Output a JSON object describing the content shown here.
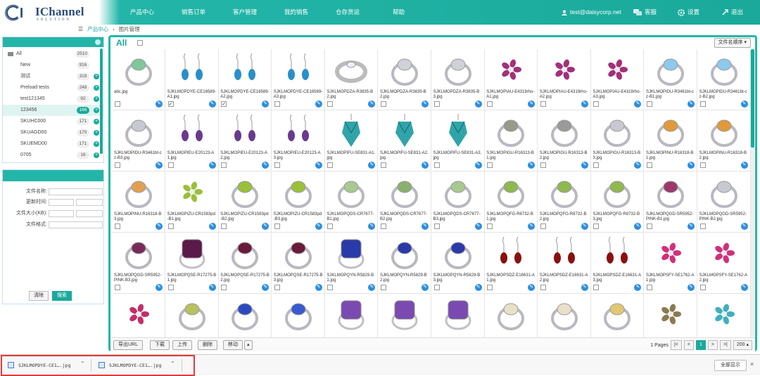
{
  "brand": {
    "name": "IChannel",
    "tagline": "SOLUTION"
  },
  "nav": {
    "items": [
      "产品中心",
      "销售订单",
      "客户管理",
      "我的销售",
      "仓存货运",
      "帮助"
    ],
    "user": "test@daisycorp.net",
    "service": "客服",
    "settings": "设置",
    "logout": "退出"
  },
  "breadcrumb": {
    "root": "产品中心",
    "current": "图片管理"
  },
  "sidebar": {
    "folders": [
      {
        "label": "All",
        "count": "2510",
        "add": false
      },
      {
        "label": "New",
        "count": "916",
        "add": false
      },
      {
        "label": "测试",
        "count": "319",
        "add": true
      },
      {
        "label": "Preload tests",
        "count": "248",
        "add": true
      },
      {
        "label": "test121345",
        "count": "92",
        "add": true
      },
      {
        "label": "123456",
        "count": "166",
        "add": true
      },
      {
        "label": "SKUHC000",
        "count": "171",
        "add": true
      },
      {
        "label": "SKUAGD00",
        "count": "170",
        "add": true
      },
      {
        "label": "SKUEMD00",
        "count": "171",
        "add": true
      },
      {
        "label": "0705",
        "count": "16",
        "add": true
      }
    ],
    "selected_index": 5
  },
  "search": {
    "fields": [
      {
        "label": "文件名称:"
      },
      {
        "label": "更新时间:"
      },
      {
        "label": "文件大小(KB):"
      },
      {
        "label": "文件格式:"
      }
    ],
    "clear_label": "清除",
    "search_label": "搜索"
  },
  "gallery": {
    "title": "All",
    "sort_label": "文件名顺序",
    "tiles": [
      {
        "name": "abc.jpg",
        "checked": false,
        "kind": "ring",
        "color": "#7ec89a"
      },
      {
        "name": "SJKLMOPDYE-CE16589-A1.jpg",
        "checked": true,
        "kind": "drop",
        "color": "#2a8fc8"
      },
      {
        "name": "SJKLMOPDYE-CE16589-A2.jpg",
        "checked": true,
        "kind": "drop",
        "color": "#2a8fc8"
      },
      {
        "name": "SJKLMOPDYE-CE16589-A3.jpg",
        "checked": false,
        "kind": "drop",
        "color": "#2a8fc8"
      },
      {
        "name": "SJKLMOPDZA-R3835-B2.jpg",
        "checked": false,
        "kind": "band",
        "color": "#b8b8c0"
      },
      {
        "name": "SJKLMOPDZA-R3835-B2.jpg",
        "checked": false,
        "kind": "ring",
        "color": "#d0d0d8"
      },
      {
        "name": "SJKLMOPDZA-R3835-B3.jpg",
        "checked": false,
        "kind": "ring",
        "color": "#d0d0d8"
      },
      {
        "name": "SJKLMOPIAU-E4319rho-A1.jpg",
        "checked": false,
        "kind": "flower",
        "color": "#a3307a"
      },
      {
        "name": "SJKLMOPIAU-E4319rho-A2.jpg",
        "checked": false,
        "kind": "flower",
        "color": "#a3307a"
      },
      {
        "name": "SJKLMOPIAU-E4319rho-A3.jpg",
        "checked": false,
        "kind": "flower",
        "color": "#a3307a"
      },
      {
        "name": "SJKLMOPIDU-R3461bt-cz-B1.jpg",
        "checked": false,
        "kind": "ring",
        "color": "#8cc9ec"
      },
      {
        "name": "SJKLMOPIDU-R3461bt-cz-B2.jpg",
        "checked": false,
        "kind": "ring",
        "color": "#8cc9ec"
      },
      {
        "name": "SJKLMOPIDU-R3461bt-cz-B3.jpg",
        "checked": false,
        "kind": "ring",
        "color": "#c8c8d0"
      },
      {
        "name": "SJKLMOPIEU-E20123-A1.jpg",
        "checked": false,
        "kind": "drop",
        "color": "#6a3a8e"
      },
      {
        "name": "SJKLMOPIEU-E20123-A2.jpg",
        "checked": false,
        "kind": "drop",
        "color": "#6a3a8e"
      },
      {
        "name": "SJKLMOPIEU-E20123-A3.jpg",
        "checked": false,
        "kind": "drop",
        "color": "#6a3a8e"
      },
      {
        "name": "SJKLMOPIFU-SE831-A1.jpg",
        "checked": false,
        "kind": "crystal",
        "color": "#1a9aa0"
      },
      {
        "name": "SJKLMOPIFU-SE831-A2.jpg",
        "checked": false,
        "kind": "crystal",
        "color": "#1a9aa0"
      },
      {
        "name": "SJKLMOPIFU-SE831-A3.jpg",
        "checked": false,
        "kind": "crystal",
        "color": "#1a9aa0"
      },
      {
        "name": "SJKLMOPIGU-R16313-B1.jpg",
        "checked": false,
        "kind": "ring",
        "color": "#9a9a8a"
      },
      {
        "name": "SJKLMOPIGU-R16313-B2.jpg",
        "checked": false,
        "kind": "ring",
        "color": "#9a9a9a"
      },
      {
        "name": "SJKLMOPIGU-R16313-B3.jpg",
        "checked": false,
        "kind": "ring",
        "color": "#c8c8d0"
      },
      {
        "name": "SJKLMOPINU-R16318-B1.jpg",
        "checked": false,
        "kind": "ring",
        "color": "#e09a3a"
      },
      {
        "name": "SJKLMOPINU-R16318-B2.jpg",
        "checked": false,
        "kind": "ring",
        "color": "#e09a3a"
      },
      {
        "name": "SJKLMOPINU-R16318-B3.jpg",
        "checked": false,
        "kind": "ring",
        "color": "#e0a050"
      },
      {
        "name": "SJKLMOPIZU-CR1583pd-B1.jpg",
        "checked": false,
        "kind": "flower",
        "color": "#9ac03a"
      },
      {
        "name": "SJKLMOPIZU-CR1583pd-B2.jpg",
        "checked": false,
        "kind": "ring",
        "color": "#9ac03a"
      },
      {
        "name": "SJKLMOPIZU-CR1583pd-B3.jpg",
        "checked": false,
        "kind": "ring",
        "color": "#9ac03a"
      },
      {
        "name": "SJKLMOPQDS-CR7677-B1.jpg",
        "checked": false,
        "kind": "ring",
        "color": "#a8c890"
      },
      {
        "name": "SJKLMOPQDS-CR7677-B2.jpg",
        "checked": false,
        "kind": "ring",
        "color": "#8ab070"
      },
      {
        "name": "SJKLMOPQDS-CR7677-B3.jpg",
        "checked": false,
        "kind": "ring",
        "color": "#a8c890"
      },
      {
        "name": "SJKLMOPQFG-R8732-B1.jpg",
        "checked": false,
        "kind": "ring",
        "color": "#90b850"
      },
      {
        "name": "SJKLMOPQFG-R8732-B2.jpg",
        "checked": false,
        "kind": "ring",
        "color": "#90b850"
      },
      {
        "name": "SJKLMOPQFG-R8732-B3.jpg",
        "checked": false,
        "kind": "ring",
        "color": "#90b850"
      },
      {
        "name": "SJKLMOPQGD-SR5952-PINK-B1.jpg",
        "checked": false,
        "kind": "ring",
        "color": "#9a3a6a"
      },
      {
        "name": "SJKLMOPQGD-SR5952-PINK-B2.jpg",
        "checked": false,
        "kind": "ring",
        "color": "#c8c8d0"
      },
      {
        "name": "SJKLMOPQGD-SR5952-PINK-B3.jpg",
        "checked": false,
        "kind": "ring",
        "color": "#7a2a5a"
      },
      {
        "name": "SJKLMOPQSE-R17275-B1.jpg",
        "checked": false,
        "kind": "gem",
        "color": "#5a1a4a"
      },
      {
        "name": "SJKLMOPQSE-R17275-B2.jpg",
        "checked": false,
        "kind": "ring",
        "color": "#6a1a3a"
      },
      {
        "name": "SJKLMOPQSE-R17275-B3.jpg",
        "checked": false,
        "kind": "ring",
        "color": "#6a1a3a"
      },
      {
        "name": "SJKLMOPQYN-R5829-B1.jpg",
        "checked": false,
        "kind": "gem",
        "color": "#2a3aa8"
      },
      {
        "name": "SJKLMOPQYN-R5829-B2.jpg",
        "checked": false,
        "kind": "ring",
        "color": "#2a3aa8"
      },
      {
        "name": "SJKLMOPQYN-R5829-B3.jpg",
        "checked": false,
        "kind": "ring",
        "color": "#2a3aa8"
      },
      {
        "name": "SJKLMOPSDZ-E16631-A1.jpg",
        "checked": false,
        "kind": "drop",
        "color": "#8a1010"
      },
      {
        "name": "SJKLMOPSDZ-E16631-A2.jpg",
        "checked": false,
        "kind": "drop",
        "color": "#8a1010"
      },
      {
        "name": "SJKLMOPSDZ-E16631-A3.jpg",
        "checked": false,
        "kind": "drop",
        "color": "#8a1010"
      },
      {
        "name": "SJKLMOPSFY-SE1762-A1.jpg",
        "checked": false,
        "kind": "flower",
        "color": "#d0307a"
      },
      {
        "name": "SJKLMOPSFY-SE1762-A2.jpg",
        "checked": false,
        "kind": "flower",
        "color": "#d0307a"
      },
      {
        "name": "",
        "checked": false,
        "kind": "flower",
        "color": "#c0306a"
      },
      {
        "name": "",
        "checked": false,
        "kind": "ring",
        "color": "#b8c060"
      },
      {
        "name": "",
        "checked": false,
        "kind": "ring",
        "color": "#2a4ac0"
      },
      {
        "name": "",
        "checked": false,
        "kind": "ring",
        "color": "#3a5ad0"
      },
      {
        "name": "",
        "checked": false,
        "kind": "gem",
        "color": "#7a4ab0"
      },
      {
        "name": "",
        "checked": false,
        "kind": "gem",
        "color": "#7a4ab0"
      },
      {
        "name": "",
        "checked": false,
        "kind": "gem",
        "color": "#7a4ab0"
      },
      {
        "name": "",
        "checked": false,
        "kind": "ring",
        "color": "#e8e0c8"
      },
      {
        "name": "",
        "checked": false,
        "kind": "ring",
        "color": "#e8e0c8"
      },
      {
        "name": "",
        "checked": false,
        "kind": "ring",
        "color": "#e0c870"
      },
      {
        "name": "",
        "checked": false,
        "kind": "flower",
        "color": "#8a7a50"
      },
      {
        "name": "",
        "checked": false,
        "kind": "flower",
        "color": "#40b0c0"
      }
    ]
  },
  "toolbar": {
    "export_url": "导出URL",
    "download": "下载",
    "upload": "上传",
    "delete": "删除",
    "move": "移动"
  },
  "pager": {
    "pages_label": "1 Pages",
    "first": "|<",
    "prev": "<",
    "current": "1",
    "next": ">",
    "last": ">|",
    "page_size": "200"
  },
  "downloads": {
    "items": [
      "SJKLMOPDYE-CE1….jpg",
      "SJKLMOPDYE-CE1….jpg"
    ],
    "show_all": "全部显示",
    "close": "×"
  },
  "colors": {
    "accent": "#1aa99b",
    "highlight": "#e23b3b"
  }
}
